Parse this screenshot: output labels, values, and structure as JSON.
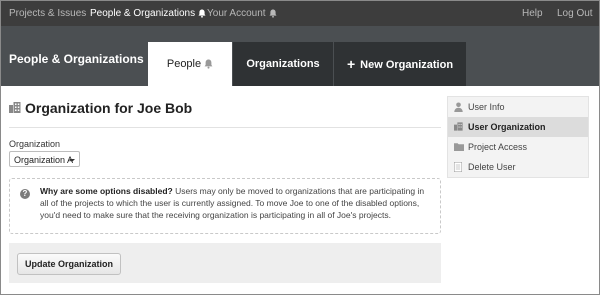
{
  "topnav": {
    "items": [
      {
        "label": "Projects & Issues"
      },
      {
        "label": "People & Organizations"
      },
      {
        "label": "Your Account"
      }
    ],
    "help": "Help",
    "logout": "Log Out"
  },
  "header": {
    "section_title": "People & Organizations",
    "tabs": [
      {
        "label": "People"
      },
      {
        "label": "Organizations"
      },
      {
        "label": "New Organization"
      }
    ]
  },
  "main": {
    "title": "Organization for Joe Bob",
    "field_label": "Organization",
    "selected_option": "Organization A",
    "notice": {
      "question": "Why are some options disabled?",
      "body": " Users may only be moved to organizations that are participating in all of the projects to which the user is currently assigned. To move Joe to one of the disabled options, you'd need to make sure that the receiving organization is participating in all of Joe's projects."
    },
    "button_label": "Update Organization"
  },
  "sidebar": {
    "items": [
      {
        "label": "User Info",
        "icon": "user-icon"
      },
      {
        "label": "User Organization",
        "icon": "building-icon"
      },
      {
        "label": "Project Access",
        "icon": "folder-icon"
      },
      {
        "label": "Delete User",
        "icon": "document-icon"
      }
    ]
  },
  "colors": {
    "topnav_bg": "#3d3d3d",
    "header_bg": "#4b4f52",
    "tab_dark_bg": "#2f3234",
    "sidebar_active_bg": "#dcdcdc"
  }
}
